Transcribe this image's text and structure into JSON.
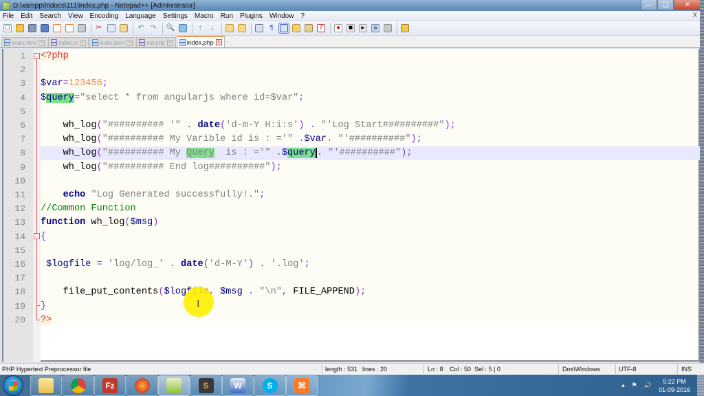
{
  "window": {
    "title": "D:\\xampp\\htdocs\\111\\index.php - Notepad++ [Administrator]",
    "controls": [
      "minimize",
      "restore",
      "close"
    ]
  },
  "menu": [
    "File",
    "Edit",
    "Search",
    "View",
    "Encoding",
    "Language",
    "Settings",
    "Macro",
    "Run",
    "Plugins",
    "Window",
    "?"
  ],
  "menu_close": "X",
  "toolbar": [
    "new-file",
    "open-file",
    "save",
    "save-all",
    "close",
    "close-all",
    "print",
    "|",
    "cut",
    "copy",
    "paste",
    "|",
    "undo",
    "redo",
    "|",
    "find",
    "replace",
    "|",
    "zoom-in",
    "zoom-out",
    "|",
    "sync-vertical",
    "sync-horizontal",
    "|",
    "word-wrap",
    "show-all-chars",
    "indent-guide",
    "user-defined-lang",
    "doc-map",
    "function-list",
    "|",
    "record-macro",
    "stop-macro",
    "play-macro",
    "run-macro-multiple",
    "save-macro",
    "|",
    "open-folder"
  ],
  "tabs": [
    {
      "label": "index.html",
      "icon": "blue",
      "active": false
    },
    {
      "label": "index.js",
      "icon": "purple",
      "active": false
    },
    {
      "label": "index.html",
      "icon": "blue",
      "active": false
    },
    {
      "label": "md.php",
      "icon": "purple",
      "active": false
    },
    {
      "label": "index.php",
      "icon": "blue",
      "active": true
    }
  ],
  "tab_close_glyph": "×",
  "editor": {
    "current_line": 8,
    "lines": [
      {
        "n": "1",
        "tokens": [
          [
            "php",
            "<?php"
          ]
        ]
      },
      {
        "n": "2",
        "tokens": []
      },
      {
        "n": "3",
        "tokens": [
          [
            "var",
            "$var"
          ],
          [
            "op",
            "="
          ],
          [
            "num",
            "123456"
          ],
          [
            "op",
            ";"
          ]
        ]
      },
      {
        "n": "4",
        "tokens": [
          [
            "var",
            "$"
          ],
          [
            "var hl",
            "query"
          ],
          [
            "op",
            "="
          ],
          [
            "str",
            "\"select * from angularjs where id=$var\""
          ],
          [
            "op",
            ";"
          ]
        ]
      },
      {
        "n": "5",
        "tokens": []
      },
      {
        "n": "6",
        "tokens": [
          [
            "plain",
            "    wh_log"
          ],
          [
            "op",
            "("
          ],
          [
            "str",
            "\"########## '\""
          ],
          [
            "plain",
            " "
          ],
          [
            "op",
            "."
          ],
          [
            "plain",
            " "
          ],
          [
            "fn",
            "date"
          ],
          [
            "op",
            "("
          ],
          [
            "str",
            "'d-m-Y H:i:s'"
          ],
          [
            "op",
            ")"
          ],
          [
            "plain",
            " "
          ],
          [
            "op",
            "."
          ],
          [
            "plain",
            " "
          ],
          [
            "str",
            "\"'Log Start##########\""
          ],
          [
            "op",
            ");"
          ]
        ]
      },
      {
        "n": "7",
        "tokens": [
          [
            "plain",
            "    wh_log"
          ],
          [
            "op",
            "("
          ],
          [
            "str",
            "\"########## My Varible id is : ='\""
          ],
          [
            "plain",
            " "
          ],
          [
            "op",
            "."
          ],
          [
            "var",
            "$var"
          ],
          [
            "op",
            "."
          ],
          [
            "plain",
            " "
          ],
          [
            "str",
            "\"'##########\""
          ],
          [
            "op",
            ");"
          ]
        ]
      },
      {
        "n": "8",
        "tokens": [
          [
            "plain",
            "    wh_log"
          ],
          [
            "op",
            "("
          ],
          [
            "str",
            "\"########## My "
          ],
          [
            "str hl",
            "Query"
          ],
          [
            "str",
            "  is : ='\""
          ],
          [
            "plain",
            " "
          ],
          [
            "op",
            "."
          ],
          [
            "var",
            "$"
          ],
          [
            "var hl caret",
            "query"
          ],
          [
            "op",
            "."
          ],
          [
            "plain",
            " "
          ],
          [
            "str",
            "\"'##########\""
          ],
          [
            "op",
            ");"
          ]
        ]
      },
      {
        "n": "9",
        "tokens": [
          [
            "plain",
            "    wh_log"
          ],
          [
            "op",
            "("
          ],
          [
            "str",
            "\"########## End log##########\""
          ],
          [
            "op",
            ");"
          ]
        ]
      },
      {
        "n": "10",
        "tokens": []
      },
      {
        "n": "11",
        "tokens": [
          [
            "plain",
            "    "
          ],
          [
            "kw",
            "echo"
          ],
          [
            "plain",
            " "
          ],
          [
            "str",
            "\"Log Generated successfully!.\""
          ],
          [
            "op",
            ";"
          ]
        ]
      },
      {
        "n": "12",
        "tokens": [
          [
            "cmt",
            "//Common Function"
          ]
        ]
      },
      {
        "n": "13",
        "tokens": [
          [
            "kw",
            "function"
          ],
          [
            "plain",
            " wh_log"
          ],
          [
            "op",
            "("
          ],
          [
            "var",
            "$msg"
          ],
          [
            "op",
            ")"
          ]
        ]
      },
      {
        "n": "14",
        "tokens": [
          [
            "op",
            "{"
          ]
        ]
      },
      {
        "n": "15",
        "tokens": []
      },
      {
        "n": "16",
        "tokens": [
          [
            "plain",
            " "
          ],
          [
            "var",
            "$logfile"
          ],
          [
            "plain",
            " "
          ],
          [
            "op",
            "="
          ],
          [
            "plain",
            " "
          ],
          [
            "str",
            "'log/log_'"
          ],
          [
            "plain",
            " "
          ],
          [
            "op",
            "."
          ],
          [
            "plain",
            " "
          ],
          [
            "fn",
            "date"
          ],
          [
            "op",
            "("
          ],
          [
            "str",
            "'d-M-Y'"
          ],
          [
            "op",
            ")"
          ],
          [
            "plain",
            " "
          ],
          [
            "op",
            "."
          ],
          [
            "plain",
            " "
          ],
          [
            "str",
            "'.log'"
          ],
          [
            "op",
            ";"
          ]
        ]
      },
      {
        "n": "17",
        "tokens": []
      },
      {
        "n": "18",
        "tokens": [
          [
            "plain",
            "    file_put_contents"
          ],
          [
            "op",
            "("
          ],
          [
            "var",
            "$logfile"
          ],
          [
            "op",
            ","
          ],
          [
            "plain",
            " "
          ],
          [
            "var",
            "$msg"
          ],
          [
            "plain",
            " "
          ],
          [
            "op",
            "."
          ],
          [
            "plain",
            " "
          ],
          [
            "str",
            "\"\\n\""
          ],
          [
            "op",
            ","
          ],
          [
            "plain",
            " FILE_APPEND"
          ],
          [
            "op",
            ");"
          ]
        ]
      },
      {
        "n": "19",
        "tokens": [
          [
            "op",
            "}"
          ]
        ]
      },
      {
        "n": "20",
        "tokens": [
          [
            "php",
            "?>"
          ]
        ]
      }
    ]
  },
  "status": {
    "file_type": "PHP Hypertext Preprocessor file",
    "length": "length : 531",
    "lines": "lines : 20",
    "ln": "Ln : 8",
    "col": "Col : 50",
    "sel": "Sel : 5 | 0",
    "eol": "Dos\\Windows",
    "encoding": "UTF-8",
    "mode": "INS"
  },
  "taskbar": {
    "apps": [
      "windows-explorer",
      "google-chrome",
      "filezilla",
      "firefox",
      "notepad-plus-plus",
      "sublime-text",
      "microsoft-word",
      "skype",
      "xampp"
    ],
    "active_app": "notepad-plus-plus",
    "time": "5:22 PM",
    "date": "01-09-2016"
  },
  "colors": {
    "current_line": "#e8e8ff",
    "match_highlight": "#7ee08e",
    "fold_marker": "#e05a5a",
    "editor_bg": "#fdfcf5"
  }
}
